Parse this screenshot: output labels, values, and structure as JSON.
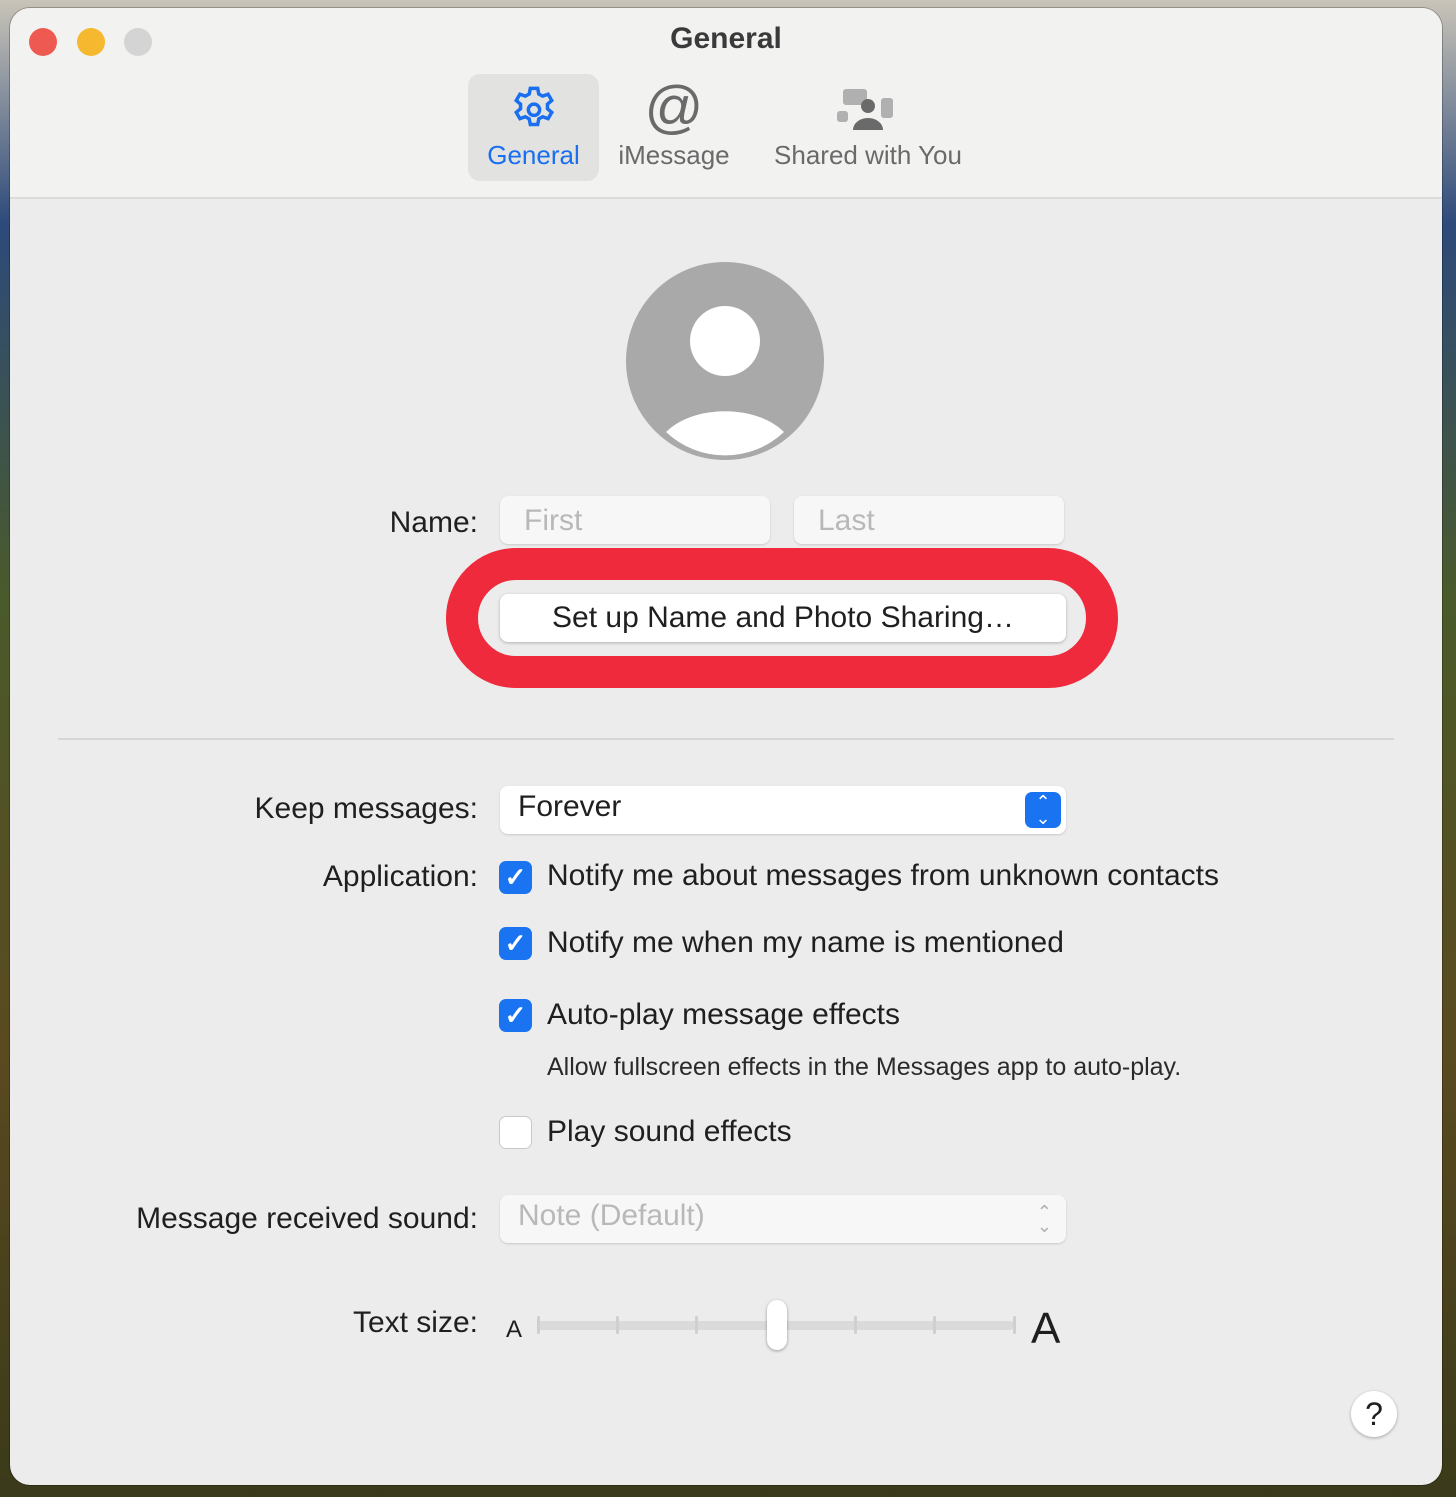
{
  "window": {
    "title": "General"
  },
  "tabs": [
    {
      "label": "General",
      "icon": "gear-icon",
      "selected": true
    },
    {
      "label": "iMessage",
      "icon": "at-icon"
    },
    {
      "label": "Shared with You",
      "icon": "shared-with-you-icon"
    }
  ],
  "name": {
    "label": "Name:",
    "first_placeholder": "First",
    "last_placeholder": "Last"
  },
  "setup_button": "Set up Name and Photo Sharing…",
  "highlight_color": "#ee2a3c",
  "keep_messages": {
    "label": "Keep messages:",
    "value": "Forever"
  },
  "application": {
    "label": "Application:",
    "options": [
      {
        "label": "Notify me about messages from unknown contacts",
        "checked": true
      },
      {
        "label": "Notify me when my name is mentioned",
        "checked": true
      },
      {
        "label": "Auto-play message effects",
        "checked": true,
        "note": "Allow fullscreen effects in the Messages app to auto-play."
      },
      {
        "label": "Play sound effects",
        "checked": false
      }
    ]
  },
  "sound": {
    "label": "Message received sound:",
    "value": "Note (Default)"
  },
  "text_size": {
    "label": "Text size:",
    "small": "A",
    "large": "A",
    "steps": 7,
    "value_index": 3
  },
  "help": "?",
  "accent": "#1a73f0"
}
